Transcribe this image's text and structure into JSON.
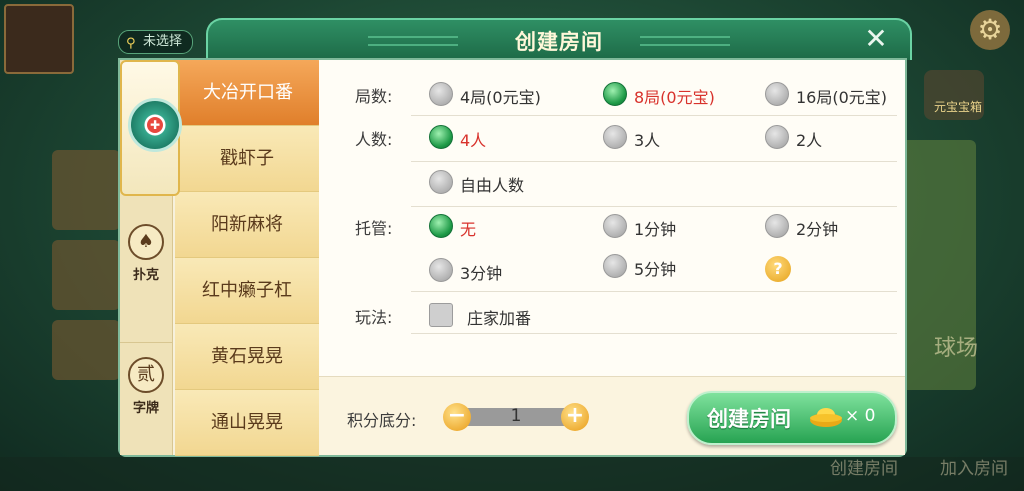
{
  "background": {
    "location": "未选择",
    "chest_label": "元宝宝箱",
    "side_label": "球场",
    "bottom_create": "创建房间",
    "bottom_join": "加入房间"
  },
  "dialog": {
    "title": "创建房间",
    "close": "✕",
    "categories": [
      {
        "label": "扑克",
        "glyph": "♠"
      },
      {
        "label": "字牌",
        "glyph": "贰"
      }
    ],
    "games": [
      "大冶开口番",
      "戳虾子",
      "阳新麻将",
      "红中癞子杠",
      "黄石晃晃",
      "通山晃晃"
    ],
    "active_game_index": 0,
    "rounds": {
      "label": "局数:",
      "options": [
        "4局(0元宝)",
        "8局(0元宝)",
        "16局(0元宝)"
      ],
      "selected": 1
    },
    "players": {
      "label": "人数:",
      "options": [
        "4人",
        "3人",
        "2人",
        "自由人数"
      ],
      "selected": 0
    },
    "auto": {
      "label": "托管:",
      "options": [
        "无",
        "1分钟",
        "2分钟",
        "3分钟",
        "5分钟"
      ],
      "selected": 0,
      "help": "?"
    },
    "play": {
      "label": "玩法:",
      "options": [
        "庄家加番"
      ]
    },
    "score": {
      "label": "积分底分:",
      "value": "1",
      "minus": "−",
      "plus": "+"
    },
    "create": {
      "label": "创建房间",
      "cost": "× 0"
    }
  },
  "colors": {
    "accent_green": "#27a352",
    "selected_text": "#d8322c",
    "active_tab": "#e07f2b"
  }
}
